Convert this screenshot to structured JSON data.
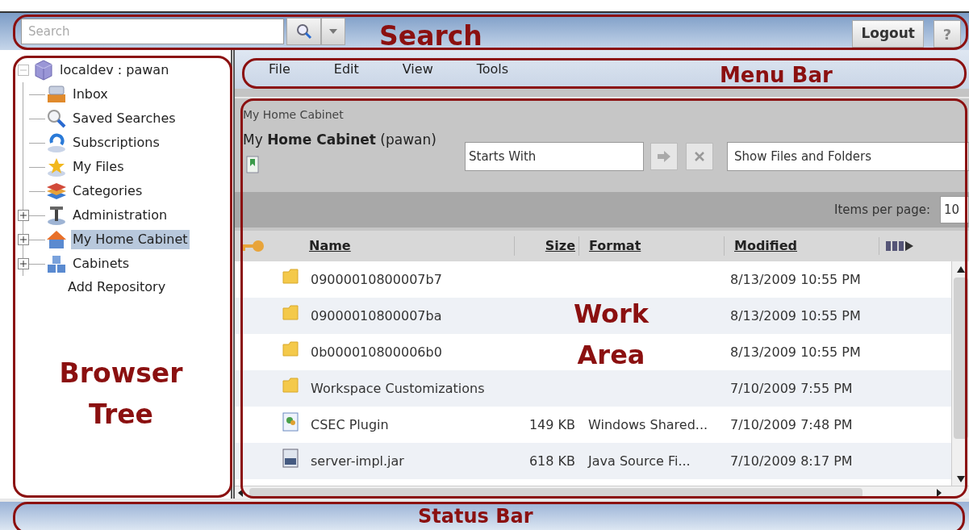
{
  "header": {
    "search": {
      "placeholder": "Search"
    },
    "logout": "Logout",
    "help": "?"
  },
  "tree": {
    "root": {
      "label": "localdev : pawan",
      "expanded": true,
      "children": [
        {
          "label": "Inbox",
          "expandable": false,
          "selected": false
        },
        {
          "label": "Saved Searches",
          "expandable": false,
          "selected": false
        },
        {
          "label": "Subscriptions",
          "expandable": false,
          "selected": false
        },
        {
          "label": "My Files",
          "expandable": false,
          "selected": false
        },
        {
          "label": "Categories",
          "expandable": false,
          "selected": false
        },
        {
          "label": "Administration",
          "expandable": true,
          "selected": false
        },
        {
          "label": "My Home Cabinet",
          "expandable": true,
          "selected": true
        },
        {
          "label": "Cabinets",
          "expandable": true,
          "selected": false
        }
      ]
    },
    "add_repository": "Add Repository"
  },
  "menu_bar": [
    "File",
    "Edit",
    "View",
    "Tools"
  ],
  "work_area": {
    "breadcrumb": "My Home Cabinet",
    "title": "My **Home Cabinet** (pawan)",
    "filter": {
      "value": "Starts With"
    },
    "view_select": "Show Files and Folders",
    "items_per_page_label": "Items per page:",
    "items_per_page": "10",
    "table": {
      "columns": [
        "Name",
        "Size",
        "Format",
        "Modified"
      ],
      "rows": [
        {
          "kind": "folder",
          "name": "09000010800007b7",
          "size": "",
          "format": "",
          "modified": "8/13/2009 10:55 PM"
        },
        {
          "kind": "folder",
          "name": "09000010800007ba",
          "size": "",
          "format": "",
          "modified": "8/13/2009 10:55 PM"
        },
        {
          "kind": "folder",
          "name": "0b000010800006b0",
          "size": "",
          "format": "",
          "modified": "8/13/2009 10:55 PM"
        },
        {
          "kind": "folder",
          "name": "Workspace Customizations",
          "size": "",
          "format": "",
          "modified": "7/10/2009 7:55 PM"
        },
        {
          "kind": "plugin",
          "name": "CSEC Plugin",
          "size": "149 KB",
          "format": "Windows Shared...",
          "modified": "7/10/2009 7:48 PM"
        },
        {
          "kind": "jar",
          "name": "server-impl.jar",
          "size": "618 KB",
          "format": "Java Source Fi...",
          "modified": "7/10/2009 8:17 PM"
        }
      ]
    }
  },
  "annotations": {
    "search": "Search",
    "menu_bar": "Menu Bar",
    "work_area": [
      "Work",
      "Area"
    ],
    "browser_tree": [
      "Browser",
      "Tree"
    ],
    "status_bar": "Status Bar"
  }
}
